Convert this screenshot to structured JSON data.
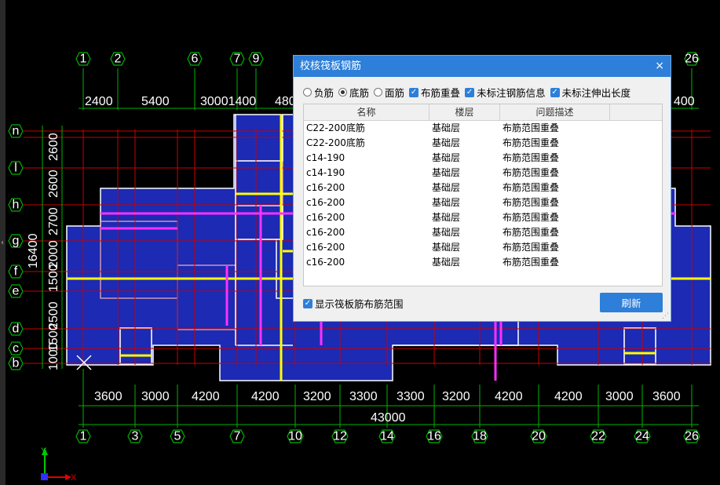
{
  "drawing": {
    "axis_top": [
      "1",
      "2",
      "6",
      "7",
      "9",
      "26"
    ],
    "axis_bottom": [
      "1",
      "3",
      "5",
      "7",
      "10",
      "12",
      "14",
      "16",
      "18",
      "20",
      "22",
      "24",
      "26"
    ],
    "axis_left": [
      "n",
      "l",
      "h",
      "g",
      "f",
      "e",
      "d",
      "c",
      "b"
    ],
    "dims_top": [
      "2400",
      "5400",
      "30001400",
      "480",
      "400"
    ],
    "dims_bottom": [
      "3600",
      "3000",
      "4200",
      "4200",
      "3200",
      "3300",
      "3300",
      "3200",
      "4200",
      "4200",
      "3000",
      "3600"
    ],
    "dim_total": "43000",
    "dims_left": [
      "2600",
      "2600",
      "2700",
      "2000",
      "1500",
      "2500",
      "1500",
      "1000"
    ],
    "dim_left_total": "16400",
    "ucs_x": "X",
    "ucs_y": "Y",
    "colors": {
      "slab": "#1c2ab4",
      "grid": "#c80000",
      "dim": "#00b400",
      "rebar_yellow": "#ffff00",
      "rebar_magenta": "#ff30ff"
    }
  },
  "dialog": {
    "title": "校核筏板钢筋",
    "close": "×",
    "options": {
      "neg": "负筋",
      "bottom": "底筋",
      "top": "面筋",
      "overlap": "布筋重叠",
      "unlabeled": "未标注钢筋信息",
      "extend": "未标注伸出长度"
    },
    "columns": [
      "名称",
      "楼层",
      "问题描述"
    ],
    "rows": [
      [
        "C22-200底筋",
        "基础层",
        "布筋范围重叠"
      ],
      [
        "C22-200底筋",
        "基础层",
        "布筋范围重叠"
      ],
      [
        "c14-190",
        "基础层",
        "布筋范围重叠"
      ],
      [
        "c14-190",
        "基础层",
        "布筋范围重叠"
      ],
      [
        "c16-200",
        "基础层",
        "布筋范围重叠"
      ],
      [
        "c16-200",
        "基础层",
        "布筋范围重叠"
      ],
      [
        "c16-200",
        "基础层",
        "布筋范围重叠"
      ],
      [
        "c16-200",
        "基础层",
        "布筋范围重叠"
      ],
      [
        "c16-200",
        "基础层",
        "布筋范围重叠"
      ],
      [
        "c16-200",
        "基础层",
        "布筋范围重叠"
      ]
    ],
    "show_range": "显示筏板筋布筋范围",
    "refresh": "刷新"
  }
}
